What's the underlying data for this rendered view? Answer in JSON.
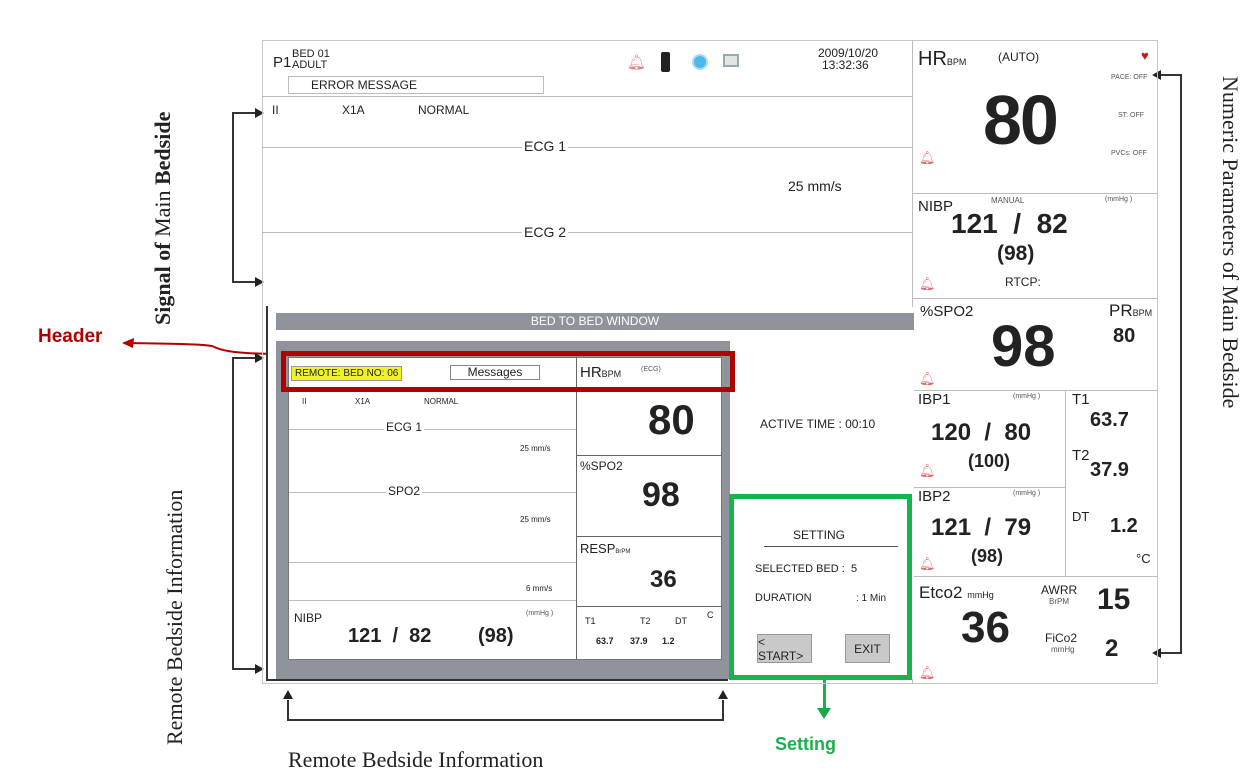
{
  "labels": {
    "signal_main_a": "Signal of",
    "signal_main_b": "Main",
    "signal_main_c": "Bedside",
    "numeric_main": "Numeric Parameters of Main Bedside",
    "remote_info_vertical": "Remote Bedside Information",
    "remote_info_bottom": "Remote Bedside Information",
    "header": "Header",
    "setting": "Setting"
  },
  "topbar": {
    "patient": "P1",
    "bed": "BED 01",
    "type": "ADULT",
    "date": "2009/10/20",
    "time": "13:32:36",
    "error": "ERROR MESSAGE",
    "icons": [
      "alarm-bell-icon",
      "battery-icon",
      "network-icon",
      "monitor-icon"
    ]
  },
  "main_waves": {
    "lead": "II",
    "filter": "X1A",
    "mode": "NORMAL",
    "ecg1": "ECG 1",
    "ecg2": "ECG 2",
    "speed": "25 mm/s"
  },
  "hr": {
    "label": "HR",
    "unit": "BPM",
    "mode": "(AUTO)",
    "value": "80",
    "pace": "PACE: OFF",
    "st": "ST: OFF",
    "pvcs": "PVCs: OFF"
  },
  "nibp": {
    "label": "NIBP",
    "mode": "MANUAL",
    "unit": "(mmHg )",
    "value": "121  /  82",
    "mean": "(98)",
    "rtcp": "RTCP:"
  },
  "spo2": {
    "label": "%SPO2",
    "value": "98",
    "pr_label": "PR",
    "pr_unit": "BPM",
    "pr_value": "80"
  },
  "ibp1": {
    "label": "IBP1",
    "unit": "(mmHg )",
    "value": "120  /  80",
    "mean": "(100)"
  },
  "temps": {
    "t1_label": "T1",
    "t1": "63.7",
    "t2_label": "T2",
    "t2": "37.9",
    "dt_label": "DT",
    "dt": "1.2",
    "unit": "°C"
  },
  "ibp2": {
    "label": "IBP2",
    "unit": "(mmHg )",
    "value": "121  /  79",
    "mean": "(98)"
  },
  "etco2": {
    "label": "Etco2",
    "unit": "mmHg",
    "value": "36",
    "awrr_label": "AWRR",
    "awrr_unit": "BrPM",
    "awrr": "15",
    "fico2_label": "FiCo2",
    "fico2_unit": "mmHg",
    "fico2": "2"
  },
  "b2b": {
    "title": "BED TO BED WINDOW",
    "remote_bed": "REMOTE: BED NO: 06",
    "messages": "Messages",
    "hr_label": "HR",
    "hr_unit": "BPM",
    "hr_mode": "(ECG)",
    "hr_value": "80",
    "lead": "II",
    "filter": "X1A",
    "mode": "NORMAL",
    "ecg1": "ECG 1",
    "spo2_wave": "SPO2",
    "speed1": "25 mm/s",
    "speed2": "25 mm/s",
    "speed3": "6 mm/s",
    "spo2_label": "%SPO2",
    "spo2_value": "98",
    "resp_label": "RESP",
    "resp_unit": "BrPM",
    "resp_value": "36",
    "nibp_label": "NIBP",
    "nibp_unit": "(mmHg )",
    "nibp_value": "121  /  82",
    "nibp_mean": "(98)",
    "t1_label": "T1",
    "t2_label": "T2",
    "dt_label": "DT",
    "temp_unit": "C",
    "t1": "63.7",
    "t2": "37.9",
    "dt": "1.2",
    "active_time": "ACTIVE TIME : 00:10"
  },
  "setting": {
    "title": "SETTING",
    "selected": "SELECTED BED :  5",
    "duration_label": "DURATION",
    "duration_value": ": 1 Min",
    "start": "< START>",
    "exit": "EXIT"
  },
  "colors": {
    "header_box": "#b00000",
    "setting_box": "#19b24b",
    "header_text": "#b00000",
    "setting_text": "#19b24b",
    "remote_highlight": "#f2f22a",
    "window_bg": "#8f949c"
  }
}
